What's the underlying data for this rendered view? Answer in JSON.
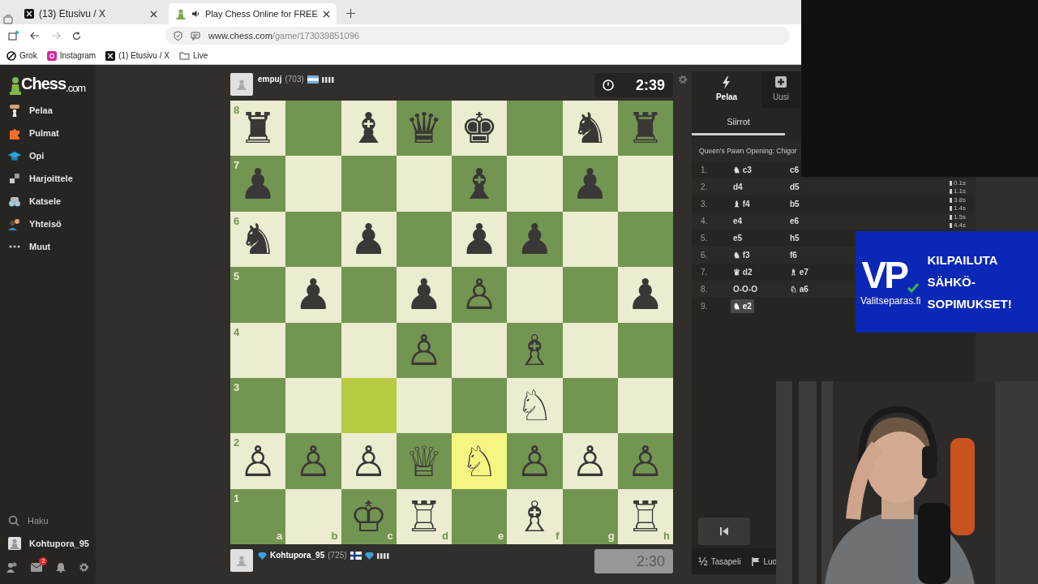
{
  "browser": {
    "tabs": [
      {
        "title": "(13) Etusivu / X",
        "kind": "x",
        "audio": false,
        "selected": false
      },
      {
        "title": "Play Chess Online for FREE",
        "kind": "chess",
        "audio": true,
        "selected": true
      }
    ],
    "address": {
      "host": "www.chess.com",
      "path": "/game/173039851096"
    },
    "bookmarks": [
      {
        "label": "Grok",
        "kind": "grok"
      },
      {
        "label": "Instagram",
        "kind": "instagram"
      },
      {
        "label": "(1) Etusivu / X",
        "kind": "x"
      },
      {
        "label": "Live",
        "kind": "folder"
      }
    ]
  },
  "sidebar": {
    "logo": {
      "main": "Chess",
      "suffix": ".com"
    },
    "items": [
      {
        "label": "Pelaa",
        "kind": "play"
      },
      {
        "label": "Pulmat",
        "kind": "puzzle"
      },
      {
        "label": "Opi",
        "kind": "learn"
      },
      {
        "label": "Harjoittele",
        "kind": "practice"
      },
      {
        "label": "Katsele",
        "kind": "watch"
      },
      {
        "label": "Yhteisö",
        "kind": "community"
      },
      {
        "label": "Muut",
        "kind": "more"
      }
    ],
    "search": "Haku",
    "user": "Kohtupora_95",
    "mail_badge": "2"
  },
  "players": [
    {
      "name": "empuj",
      "rating": "(703)",
      "flag": {
        "kind": "argentina"
      },
      "diamond": false,
      "clock": "2:39",
      "clock_active": true
    },
    {
      "name": "Kohtupora_95",
      "rating": "(725)",
      "flag": {
        "kind": "finland"
      },
      "diamond": true,
      "clock": "2:30",
      "clock_active": false
    }
  ],
  "board": {
    "ranks": [
      "8",
      "7",
      "6",
      "5",
      "4",
      "3",
      "2",
      "1"
    ],
    "files": [
      "a",
      "b",
      "c",
      "d",
      "e",
      "f",
      "g",
      "h"
    ],
    "rows": [
      [
        {
          "piece": "♜",
          "highlighted": false
        },
        {
          "highlighted": false
        },
        {
          "piece": "♝",
          "highlighted": false
        },
        {
          "piece": "♛",
          "highlighted": false
        },
        {
          "piece": "♚",
          "highlighted": false
        },
        {
          "highlighted": false
        },
        {
          "piece": "♞",
          "highlighted": false
        },
        {
          "piece": "♜",
          "highlighted": false
        }
      ],
      [
        {
          "piece": "♟",
          "highlighted": false
        },
        {
          "highlighted": false
        },
        {
          "highlighted": false
        },
        {
          "highlighted": false
        },
        {
          "piece": "♝",
          "highlighted": false
        },
        {
          "highlighted": false
        },
        {
          "piece": "♟",
          "highlighted": false
        },
        {
          "highlighted": false
        }
      ],
      [
        {
          "piece": "♞",
          "highlighted": false
        },
        {
          "highlighted": false
        },
        {
          "piece": "♟",
          "highlighted": false
        },
        {
          "highlighted": false
        },
        {
          "piece": "♟",
          "highlighted": false
        },
        {
          "piece": "♟",
          "highlighted": false
        },
        {
          "highlighted": false
        },
        {
          "highlighted": false
        }
      ],
      [
        {
          "highlighted": false
        },
        {
          "piece": "♟",
          "highlighted": false
        },
        {
          "highlighted": false
        },
        {
          "piece": "♟",
          "highlighted": false
        },
        {
          "piece": "♙",
          "highlighted": false
        },
        {
          "highlighted": false
        },
        {
          "highlighted": false
        },
        {
          "piece": "♟",
          "highlighted": false
        }
      ],
      [
        {
          "highlighted": false
        },
        {
          "highlighted": false
        },
        {
          "highlighted": false
        },
        {
          "piece": "♙",
          "highlighted": false
        },
        {
          "highlighted": false
        },
        {
          "piece": "♗",
          "highlighted": false
        },
        {
          "highlighted": false
        },
        {
          "highlighted": false
        }
      ],
      [
        {
          "highlighted": false
        },
        {
          "highlighted": false
        },
        {
          "highlighted": true
        },
        {
          "highlighted": false
        },
        {
          "highlighted": false
        },
        {
          "piece": "♘",
          "highlighted": false
        },
        {
          "highlighted": false
        },
        {
          "highlighted": false
        }
      ],
      [
        {
          "piece": "♙",
          "highlighted": false
        },
        {
          "piece": "♙",
          "highlighted": false
        },
        {
          "piece": "♙",
          "highlighted": false
        },
        {
          "piece": "♕",
          "highlighted": false
        },
        {
          "piece": "♘",
          "highlighted": true
        },
        {
          "piece": "♙",
          "highlighted": false
        },
        {
          "piece": "♙",
          "highlighted": false
        },
        {
          "piece": "♙",
          "highlighted": false
        }
      ],
      [
        {
          "highlighted": false
        },
        {
          "highlighted": false
        },
        {
          "piece": "♔",
          "highlighted": false
        },
        {
          "piece": "♖",
          "highlighted": false
        },
        {
          "highlighted": false
        },
        {
          "piece": "♗",
          "highlighted": false
        },
        {
          "highlighted": false
        },
        {
          "piece": "♖",
          "highlighted": false
        }
      ]
    ]
  },
  "panel": {
    "tabs": [
      {
        "label": "Pelaa",
        "kind": "play",
        "selected": true
      },
      {
        "label": "Uusi",
        "kind": "new",
        "selected": false
      }
    ],
    "subtab": {
      "label": "Siirrot",
      "selected": true
    },
    "opening": "Queen's Pawn Opening: Chigor",
    "moves": [
      {
        "num": "1.",
        "white": {
          "text": "♞ c3",
          "selected": false
        },
        "black": {
          "text": "c6",
          "selected": false
        }
      },
      {
        "num": "2.",
        "white": {
          "text": "d4",
          "selected": false
        },
        "black": {
          "text": "d5",
          "selected": false
        },
        "times": [
          "0.1s",
          "1.1s"
        ]
      },
      {
        "num": "3.",
        "white": {
          "text": "♝ f4",
          "selected": false
        },
        "black": {
          "text": "b5",
          "selected": false
        },
        "times": [
          "3.8s",
          "1.4s"
        ]
      },
      {
        "num": "4.",
        "white": {
          "text": "e4",
          "selected": false
        },
        "black": {
          "text": "e6",
          "selected": false
        },
        "times": [
          "1.5s",
          "4.4s"
        ]
      },
      {
        "num": "5.",
        "white": {
          "text": "e5",
          "selected": false
        },
        "black": {
          "text": "h5",
          "selected": false
        }
      },
      {
        "num": "6.",
        "white": {
          "text": "♞ f3",
          "selected": false
        },
        "black": {
          "text": "f6",
          "selected": false
        }
      },
      {
        "num": "7.",
        "white": {
          "text": "♛ d2",
          "selected": false
        },
        "black": {
          "text": "♗ e7",
          "selected": false
        }
      },
      {
        "num": "8.",
        "white": {
          "text": "O-O-O",
          "selected": false
        },
        "black": {
          "text": "♘ a6",
          "selected": false
        }
      },
      {
        "num": "9.",
        "white": {
          "text": "♞ e2",
          "selected": true
        }
      }
    ],
    "actions": [
      {
        "label": "Tasapeli",
        "glyph": "½",
        "kind": "draw"
      },
      {
        "label": "Luo",
        "kind": "resign"
      }
    ]
  },
  "ad": {
    "logo": "VP",
    "site": "Valitseparas.fi",
    "lines": [
      "KILPAILUTA",
      "SÄHKÖ-",
      "SOPIMUKSET!"
    ]
  }
}
